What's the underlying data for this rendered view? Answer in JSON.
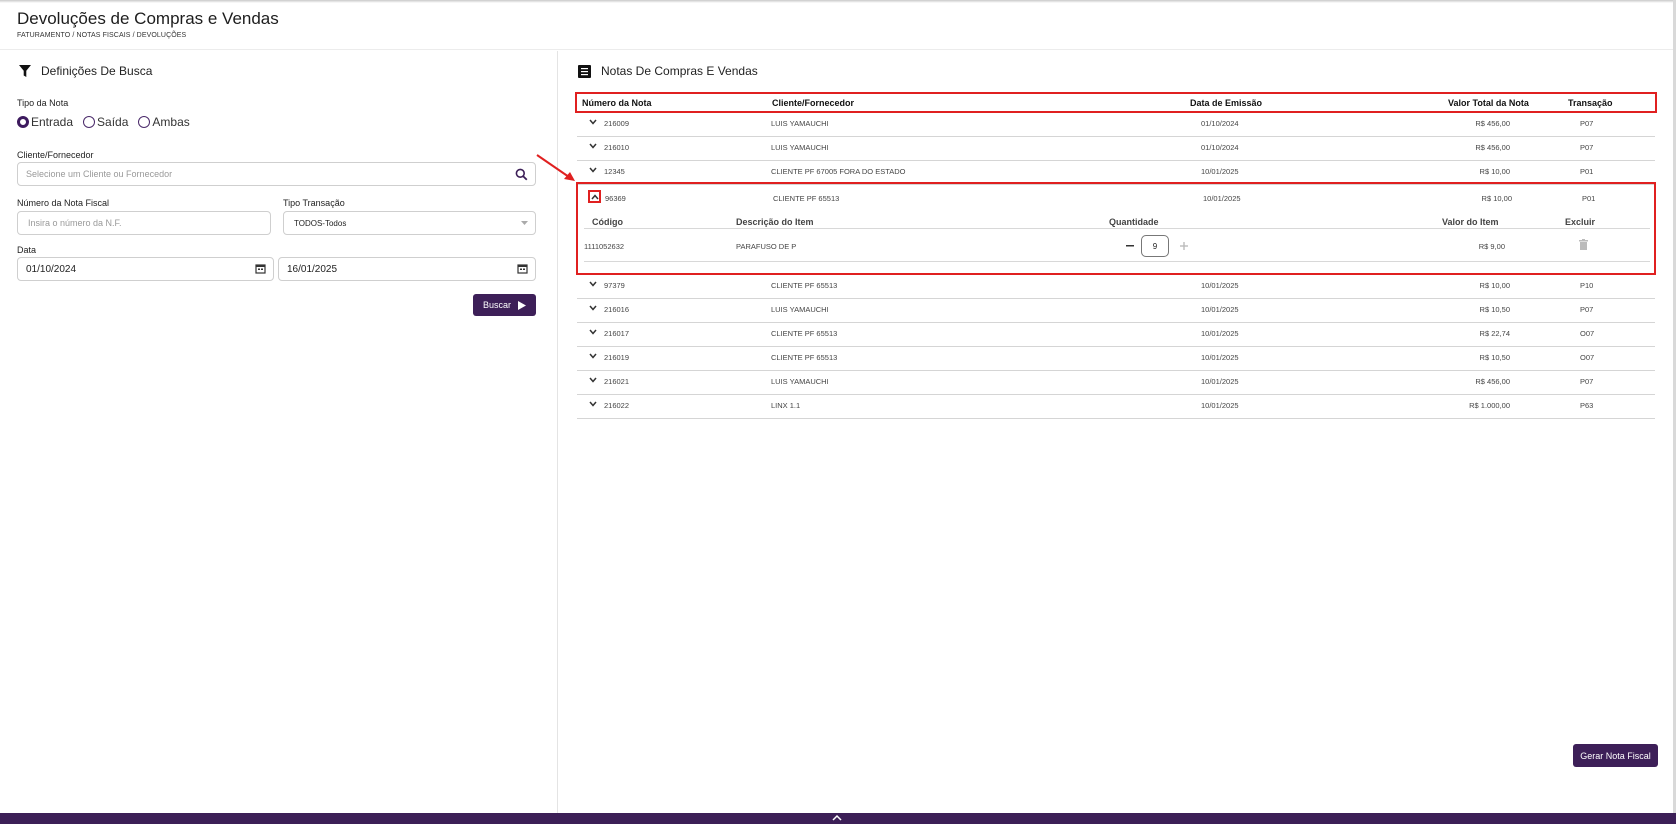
{
  "header": {
    "title": "Devoluções de Compras e Vendas",
    "breadcrumb": "FATURAMENTO / NOTAS FISCAIS / DEVOLUÇÕES"
  },
  "search": {
    "heading": "Definições De Busca",
    "tipo_nota_label": "Tipo da Nota",
    "tipo_options": [
      "Entrada",
      "Saída",
      "Ambas"
    ],
    "tipo_selected": "Entrada",
    "cliente_label": "Cliente/Fornecedor",
    "cliente_placeholder": "Selecione um Cliente ou Fornecedor",
    "numero_label": "Número da Nota Fiscal",
    "numero_placeholder": "Insira o número da N.F.",
    "tipo_transacao_label": "Tipo Transação",
    "tipo_transacao_value": "TODOS-Todos",
    "data_label": "Data",
    "data_inicio": "01/10/2024",
    "data_fim": "16/01/2025",
    "buscar_label": "Buscar"
  },
  "notas": {
    "heading": "Notas De Compras E Vendas",
    "columns": [
      "Número da Nota",
      "Cliente/Fornecedor",
      "Data de Emissão",
      "Valor Total da Nota",
      "Transação"
    ],
    "rows": [
      {
        "numero": "216009",
        "cliente": "LUIS YAMAUCHI",
        "data": "01/10/2024",
        "valor": "R$ 456,00",
        "transacao": "P07"
      },
      {
        "numero": "216010",
        "cliente": "LUIS YAMAUCHI",
        "data": "01/10/2024",
        "valor": "R$ 456,00",
        "transacao": "P07"
      },
      {
        "numero": "12345",
        "cliente": "CLIENTE PF 67005 FORA DO ESTADO",
        "data": "10/01/2025",
        "valor": "R$ 10,00",
        "transacao": "P01"
      },
      {
        "numero": "96369",
        "cliente": "CLIENTE PF 65513",
        "data": "10/01/2025",
        "valor": "R$ 10,00",
        "transacao": "P01"
      },
      {
        "numero": "97379",
        "cliente": "CLIENTE PF 65513",
        "data": "10/01/2025",
        "valor": "R$ 10,00",
        "transacao": "P10"
      },
      {
        "numero": "216016",
        "cliente": "LUIS YAMAUCHI",
        "data": "10/01/2025",
        "valor": "R$ 10,50",
        "transacao": "P07"
      },
      {
        "numero": "216017",
        "cliente": "CLIENTE PF 65513",
        "data": "10/01/2025",
        "valor": "R$ 22,74",
        "transacao": "O07"
      },
      {
        "numero": "216019",
        "cliente": "CLIENTE PF 65513",
        "data": "10/01/2025",
        "valor": "R$ 10,50",
        "transacao": "O07"
      },
      {
        "numero": "216021",
        "cliente": "LUIS YAMAUCHI",
        "data": "10/01/2025",
        "valor": "R$ 456,00",
        "transacao": "P07"
      },
      {
        "numero": "216022",
        "cliente": "LINX 1.1",
        "data": "10/01/2025",
        "valor": "R$ 1.000,00",
        "transacao": "P63"
      }
    ],
    "expanded_items": {
      "columns": [
        "Código",
        "Descrição do Item",
        "Quantidade",
        "Valor do Item",
        "Excluir"
      ],
      "item": {
        "codigo": "1111052632",
        "descricao": "PARAFUSO DE P",
        "quantidade": "9",
        "valor": "R$ 9,00"
      }
    }
  },
  "actions": {
    "gerar_label": "Gerar Nota Fiscal"
  },
  "colors": {
    "primary": "#3d1f58",
    "highlight": "#e02020"
  }
}
